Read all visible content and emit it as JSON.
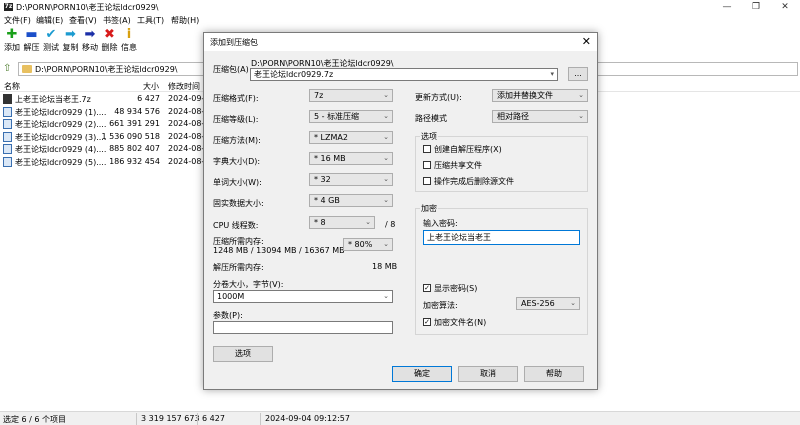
{
  "window": {
    "title": "D:\\PORN\\PORN10\\老王论坛ldcr0929\\",
    "app_icon": "7z",
    "minimize": "—",
    "maximize": "❐",
    "close": "✕"
  },
  "menu": [
    "文件(F)",
    "编辑(E)",
    "查看(V)",
    "书签(A)",
    "工具(T)",
    "帮助(H)"
  ],
  "toolbar": [
    {
      "label": "添加",
      "icon": "plus-icon",
      "glyph": "✚",
      "color": "#1aa01a"
    },
    {
      "label": "解压",
      "icon": "minus-icon",
      "glyph": "▬",
      "color": "#1b4fc9"
    },
    {
      "label": "测试",
      "icon": "check-icon",
      "glyph": "✔",
      "color": "#1c9bd0"
    },
    {
      "label": "复制",
      "icon": "copy-arrow-icon",
      "glyph": "➡",
      "color": "#1c9bd0"
    },
    {
      "label": "移动",
      "icon": "move-arrow-icon",
      "glyph": "➡",
      "color": "#1b2fa8"
    },
    {
      "label": "删除",
      "icon": "delete-x-icon",
      "glyph": "✖",
      "color": "#d81b1b"
    },
    {
      "label": "信息",
      "icon": "info-icon",
      "glyph": "i",
      "color": "#d8a010"
    }
  ],
  "address": {
    "path": "D:\\PORN\\PORN10\\老王论坛ldcr0929\\"
  },
  "list": {
    "headers": {
      "name": "名称",
      "size": "大小",
      "modified": "修改时间"
    },
    "rows": [
      {
        "name": "上老王论坛当老王.7z",
        "size": "6 427",
        "modified": "2024-09-0",
        "type": "7z"
      },
      {
        "name": "老王论坛ldcr0929 (1)....",
        "size": "48 934 576",
        "modified": "2024-08-2",
        "type": "file"
      },
      {
        "name": "老王论坛ldcr0929 (2)....",
        "size": "661 391 291",
        "modified": "2024-08-2",
        "type": "file"
      },
      {
        "name": "老王论坛ldcr0929 (3)....",
        "size": "1 536 090 518",
        "modified": "2024-08-2",
        "type": "file"
      },
      {
        "name": "老王论坛ldcr0929 (4)....",
        "size": "885 802 407",
        "modified": "2024-08-2",
        "type": "file"
      },
      {
        "name": "老王论坛ldcr0929 (5)....",
        "size": "186 932 454",
        "modified": "2024-08-2",
        "type": "file"
      }
    ]
  },
  "status": {
    "selection": "选定 6 / 6 个项目",
    "total_size": "3 319 157 673",
    "selected_size": "6 427",
    "datetime": "2024-09-04 09:12:57"
  },
  "dialog": {
    "title": "添加到压缩包",
    "close": "✕",
    "archive_label": "压缩包(A)",
    "archive_dir": "D:\\PORN\\PORN10\\老王论坛ldcr0929\\",
    "archive_name": "老王论坛ldcr0929.7z",
    "browse": "...",
    "format_label": "压缩格式(F):",
    "format_value": "7z",
    "level_label": "压缩等级(L):",
    "level_value": "5 - 标准压缩",
    "method_label": "压缩方法(M):",
    "method_value": "* LZMA2",
    "dict_label": "字典大小(D):",
    "dict_value": "* 16 MB",
    "word_label": "单词大小(W):",
    "word_value": "* 32",
    "solid_label": "固实数据大小:",
    "solid_value": "* 4 GB",
    "cpu_label": "CPU 线程数:",
    "cpu_value": "* 8",
    "cpu_max": "/ 8",
    "mem_comp_label": "压缩所需内存:",
    "mem_comp_value": "1248 MB / 13094 MB / 16367 MB",
    "mem_percent": "* 80%",
    "mem_decomp_label": "解压所需内存:",
    "mem_decomp_value": "18 MB",
    "split_label": "分卷大小，字节(V):",
    "split_value": "1000M",
    "params_label": "参数(P):",
    "params_value": "",
    "options_button": "选项",
    "update_label": "更新方式(U):",
    "update_value": "添加并替换文件",
    "path_label": "路径模式",
    "path_value": "相对路径",
    "options_group": "选项",
    "opt_sfx": "创建自解压程序(X)",
    "opt_shared": "压缩共享文件",
    "opt_delete": "操作完成后删除源文件",
    "encrypt_group": "加密",
    "password_label": "输入密码:",
    "password_value": "上老王论坛当老王",
    "show_password": "显示密码(S)",
    "enc_method_label": "加密算法:",
    "enc_method_value": "AES-256",
    "encrypt_names": "加密文件名(N)",
    "ok": "确定",
    "cancel": "取消",
    "help": "帮助"
  }
}
